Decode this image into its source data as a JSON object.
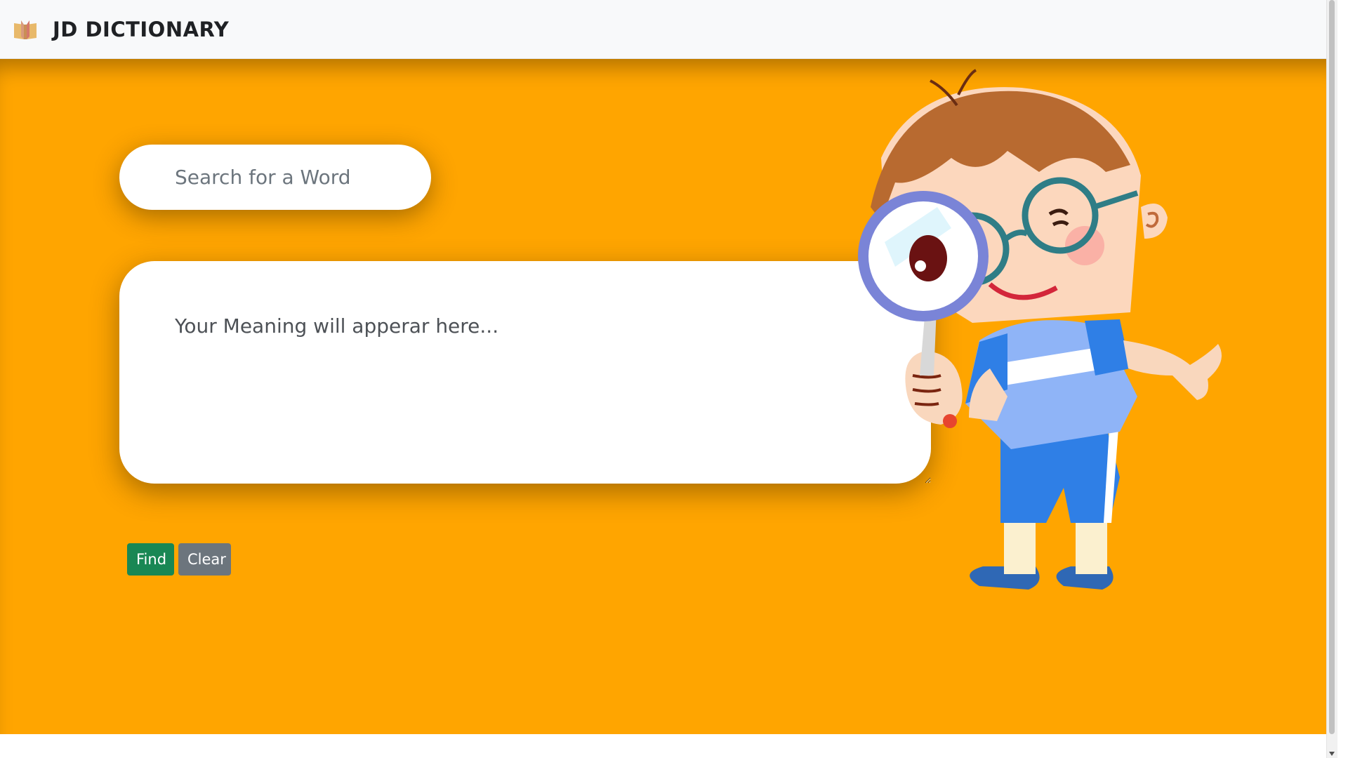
{
  "navbar": {
    "brand_icon": "open-book-icon",
    "brand_title": "JD DICTIONARY"
  },
  "search": {
    "placeholder": "Search for a Word",
    "value": ""
  },
  "meaning": {
    "placeholder": "Your Meaning will apperar here...",
    "value": ""
  },
  "actions": {
    "find_label": "Find",
    "clear_label": "Clear"
  },
  "illustration": {
    "subject": "cartoon-boy-with-magnifying-glass"
  },
  "colors": {
    "hero_background": "#ffa500",
    "navbar_background": "#f8f9fa",
    "find_button": "#198754",
    "clear_button": "#6c757d"
  }
}
